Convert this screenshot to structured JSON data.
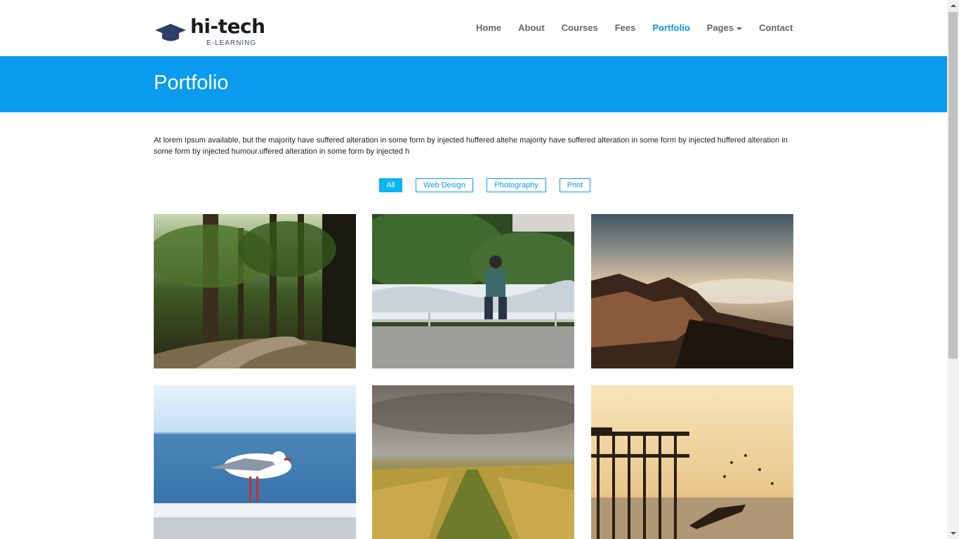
{
  "header": {
    "logo": {
      "word": "hi-tech",
      "sub": "E-LEARNING",
      "icon": "graduation-cap-icon"
    },
    "nav": [
      {
        "label": "Home"
      },
      {
        "label": "About"
      },
      {
        "label": "Courses"
      },
      {
        "label": "Fees"
      },
      {
        "label": "Portfolio",
        "active": true
      },
      {
        "label": "Pages",
        "dropdown": true
      },
      {
        "label": "Contact"
      }
    ]
  },
  "banner": {
    "title": "Portfolio",
    "color": "#0a9bef"
  },
  "intro": "At lorem Ipsum available, but the majority have suffered alteration in some form by injected huffered altehe majority have suffered alteration in some form by injected huffered alteration in some form by injected humour.uffered alteration in some form by injected h",
  "filters": [
    {
      "label": "All",
      "active": true
    },
    {
      "label": "Web Design"
    },
    {
      "label": "Photography"
    },
    {
      "label": "Print"
    }
  ],
  "gallery": [
    {
      "subject": "forest-path"
    },
    {
      "subject": "man-sitting-by-river"
    },
    {
      "subject": "rocky-cliff-sunset"
    },
    {
      "subject": "seagull-on-railing"
    },
    {
      "subject": "grassy-field-path"
    },
    {
      "subject": "ruined-pier-birds"
    }
  ],
  "accent": "#0d98e0"
}
